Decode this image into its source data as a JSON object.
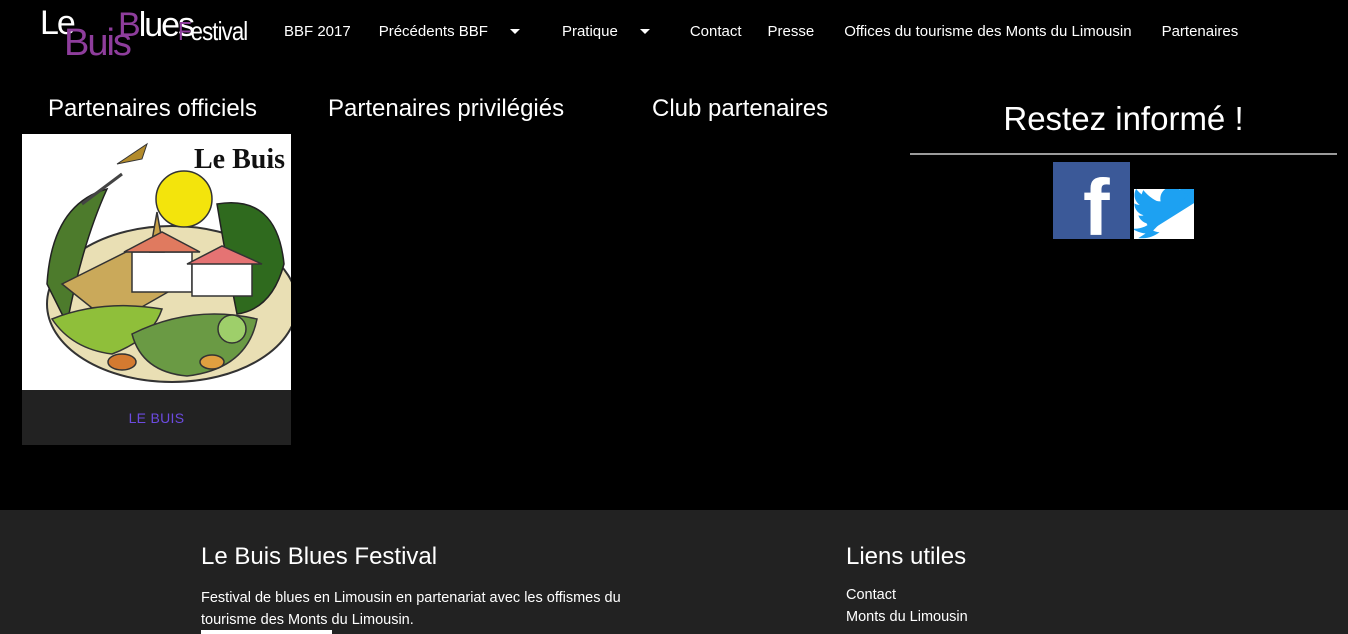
{
  "logo": {
    "le": "Le",
    "buis": "Buis",
    "blues_initial": "B",
    "blues_rest": "lues",
    "festival_initial": "F",
    "festival_rest": "estival"
  },
  "nav": {
    "items": [
      {
        "label": "BBF 2017",
        "dropdown": false
      },
      {
        "label": "Précédents BBF",
        "dropdown": true
      },
      {
        "label": "Pratique",
        "dropdown": true
      },
      {
        "label": "Contact",
        "dropdown": false
      },
      {
        "label": "Presse",
        "dropdown": false
      },
      {
        "label": "Offices du tourisme des Monts du Limousin",
        "dropdown": false
      },
      {
        "label": "Partenaires",
        "dropdown": false
      }
    ]
  },
  "partners": {
    "official_title": "Partenaires officiels",
    "privileged_title": "Partenaires privilégiés",
    "club_title": "Club partenaires",
    "card": {
      "image_title": "Le Buis",
      "caption": "LE BUIS"
    }
  },
  "sidebar": {
    "stay_informed": "Restez informé !",
    "facebook_icon": "facebook-icon",
    "twitter_icon": "twitter-icon"
  },
  "footer": {
    "col1_title": "Le Buis Blues Festival",
    "col1_text": "Festival de blues en Limousin en partenariat avec les offismes du tourisme des Monts du Limousin.",
    "col2_title": "Liens utiles",
    "links": [
      "Contact",
      "Monts du Limousin"
    ]
  },
  "colors": {
    "background": "#000000",
    "footer": "#222222",
    "accent_purple": "#8e3d9c",
    "caption_link": "#6c4be0",
    "facebook": "#3b5998",
    "twitter": "#1da1f2"
  }
}
